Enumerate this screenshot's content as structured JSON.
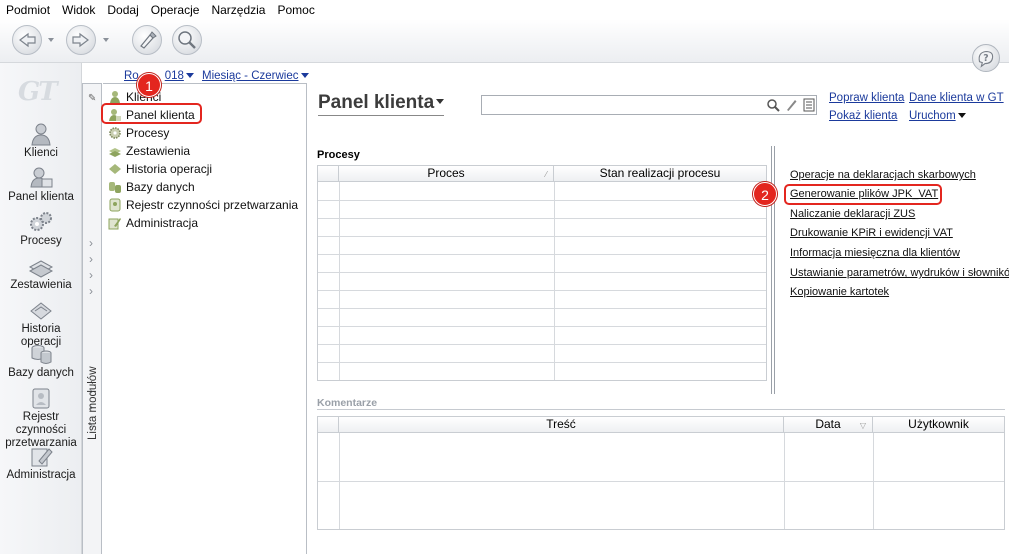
{
  "menu": [
    "Podmiot",
    "Widok",
    "Dodaj",
    "Operacje",
    "Narzędzia",
    "Pomoc"
  ],
  "toolbar": {
    "icons": [
      "back-icon",
      "forward-icon",
      "brush-icon",
      "search-person-icon"
    ],
    "help_icon": "help-icon"
  },
  "logo": "GT",
  "nav": [
    {
      "label": "Klienci",
      "icon": "clients-icon"
    },
    {
      "label": "Panel klienta",
      "icon": "client-panel-icon"
    },
    {
      "label": "Procesy",
      "icon": "gears-icon"
    },
    {
      "label": "Zestawienia",
      "icon": "reports-icon"
    },
    {
      "label": "Historia operacji",
      "icon": "history-icon"
    },
    {
      "label": "Bazy danych",
      "icon": "database-icon"
    },
    {
      "label": "Rejestr czynności przetwarzania",
      "icon": "registry-icon"
    },
    {
      "label": "Administracja",
      "icon": "admin-icon"
    }
  ],
  "module_strip": {
    "label": "Lista modułów"
  },
  "filters": {
    "year": "Rok 2018",
    "year_visible_left": "Ro",
    "year_visible_right": "018",
    "month": "Miesiąc - Czerwiec"
  },
  "tree": [
    {
      "label": "Klienci",
      "icon": "clients-icon"
    },
    {
      "label": "Panel klienta",
      "icon": "client-panel-icon"
    },
    {
      "label": "Procesy",
      "icon": "gears-icon"
    },
    {
      "label": "Zestawienia",
      "icon": "reports-icon"
    },
    {
      "label": "Historia operacji",
      "icon": "history-icon"
    },
    {
      "label": "Bazy danych",
      "icon": "database-icon"
    },
    {
      "label": "Rejestr czynności przetwarzania",
      "icon": "registry-icon"
    },
    {
      "label": "Administracja",
      "icon": "admin-icon"
    }
  ],
  "main": {
    "title": "Panel klienta",
    "search": {
      "value": "",
      "icons": [
        "search-icon",
        "pen-icon",
        "list-icon"
      ]
    },
    "links": {
      "popraw": "Popraw klienta",
      "dane": "Dane klienta w GT",
      "pokaz": "Pokaż klienta",
      "uruchom": "Uruchom"
    },
    "procesy": {
      "title": "Procesy",
      "columns": [
        "Proces",
        "Stan realizacji procesu"
      ],
      "rows": []
    },
    "operations": [
      "Operacje na deklaracjach skarbowych",
      "Generowanie plików JPK_VAT",
      "Naliczanie deklaracji ZUS",
      "Drukowanie KPiR i ewidencji VAT",
      "Informacja miesięczna dla klientów",
      "Ustawianie parametrów, wydruków i słowników",
      "Kopiowanie kartotek"
    ],
    "komentarze": {
      "title": "Komentarze",
      "columns": [
        "Treść",
        "Data",
        "Użytkownik"
      ],
      "rows": []
    }
  },
  "annotations": {
    "badge1": "1",
    "badge2": "2"
  },
  "colors": {
    "link": "#1b3a9c",
    "annotation": "#e3261f"
  }
}
